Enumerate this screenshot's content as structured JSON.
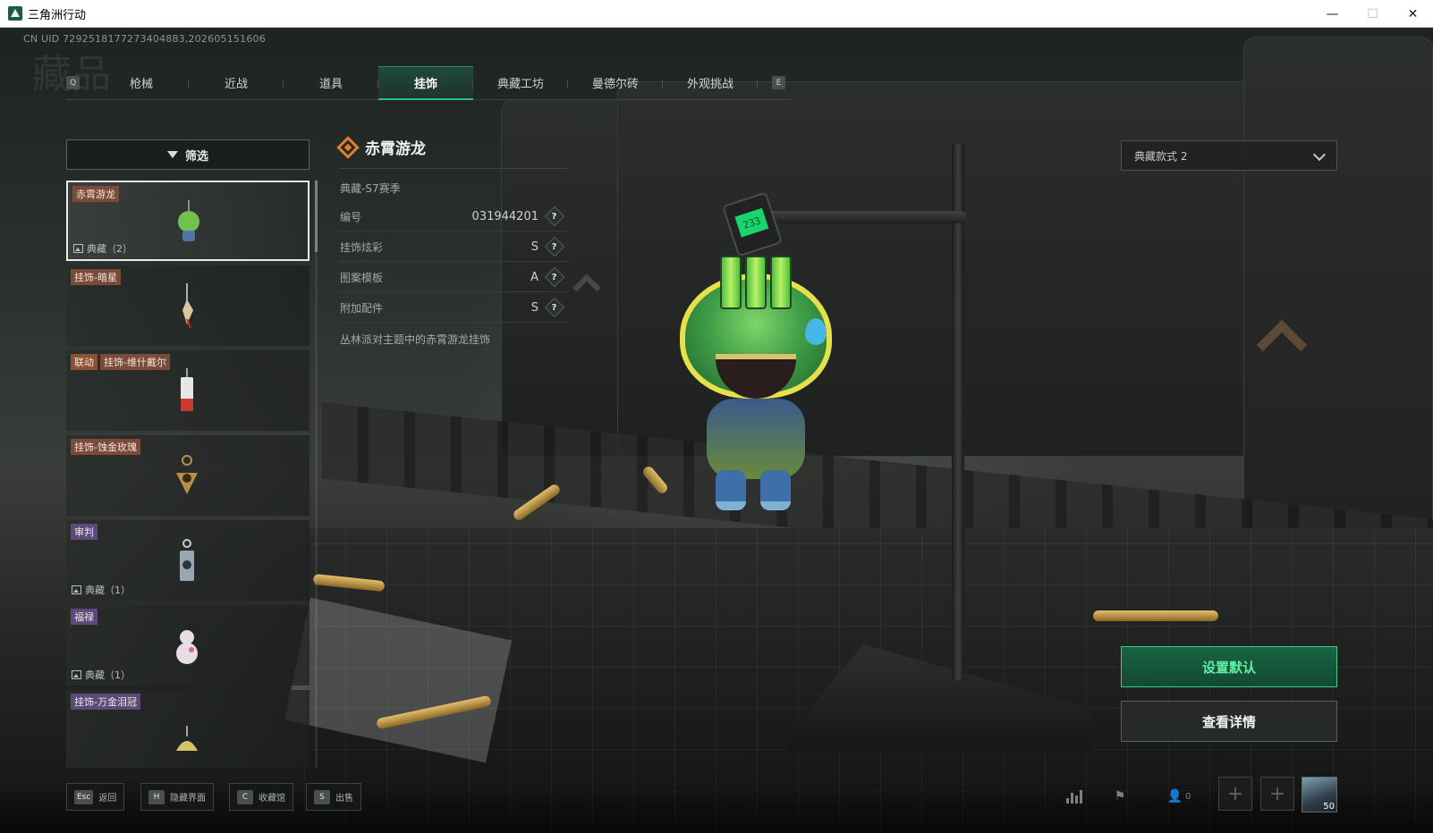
{
  "window": {
    "title": "三角洲行动",
    "controls": {
      "minimize": "—",
      "maximize": "☐",
      "close": "✕"
    }
  },
  "uid": "CN UID 7292518177273404883,202605151606",
  "page_watermark": "藏品",
  "tabs": {
    "prev_key": "Q",
    "next_key": "E",
    "items": [
      "枪械",
      "近战",
      "道具",
      "挂饰",
      "典藏工坊",
      "曼德尔砖",
      "外观挑战"
    ],
    "active": "挂饰"
  },
  "filter": {
    "label": "筛选",
    "icon": "funnel-icon"
  },
  "list": [
    {
      "tags": [
        "赤霄游龙"
      ],
      "collection": "典藏（2）",
      "selected": true,
      "thumb_color": "#6fc24e"
    },
    {
      "tags": [
        "挂饰-暗星"
      ],
      "collection": "",
      "thumb_color": "#d8c9a0"
    },
    {
      "tags": [
        "联动",
        "挂饰-维什戴尔"
      ],
      "collection": "",
      "thumb_color": "#c8392f"
    },
    {
      "tags": [
        "挂饰-蚀金玫瑰"
      ],
      "collection": "",
      "thumb_color": "#b59245"
    },
    {
      "tags": [
        "审判"
      ],
      "collection": "典藏（1）",
      "thumb_color": "#9aa7b0"
    },
    {
      "tags": [
        "福禄"
      ],
      "collection": "典藏（1）",
      "thumb_color": "#e8dce6"
    },
    {
      "tags": [
        "挂饰-万金泪冠"
      ],
      "collection": "",
      "thumb_color": "#d4c46a"
    }
  ],
  "detail": {
    "title": "赤霄游龙",
    "season": "典藏-S7赛季",
    "attributes": [
      {
        "label": "编号",
        "value": "031944201"
      },
      {
        "label": "挂饰炫彩",
        "value": "S"
      },
      {
        "label": "图案模板",
        "value": "A"
      },
      {
        "label": "附加配件",
        "value": "S"
      }
    ],
    "help_glyph": "?",
    "description": "丛林派对主题中的赤霄游龙挂饰"
  },
  "scale_display": "233",
  "style_select": {
    "value": "典藏款式 2"
  },
  "buttons": {
    "set_default": "设置默认",
    "view_detail": "查看详情"
  },
  "hotkeys": [
    {
      "key": "Esc",
      "label": "返回"
    },
    {
      "key": "H",
      "label": "隐藏界面"
    },
    {
      "key": "C",
      "label": "收藏馆"
    },
    {
      "key": "S",
      "label": "出售"
    }
  ],
  "status": {
    "friends_count": "0",
    "avatar_level": "50"
  },
  "colors": {
    "accent_green": "#2fd08a",
    "tag_brown": "#7a4b38",
    "tag_purple": "#5c4a7a",
    "brand_orange": "#e67c2e"
  }
}
